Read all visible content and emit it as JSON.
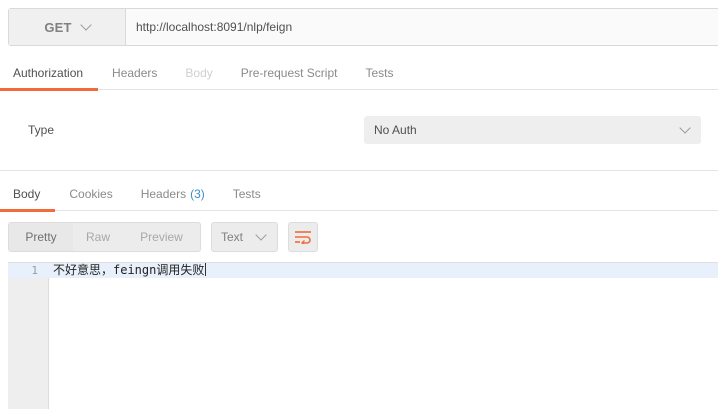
{
  "request": {
    "method": "GET",
    "url": "http://localhost:8091/nlp/feign"
  },
  "request_tabs": [
    {
      "label": "Authorization",
      "state": "active"
    },
    {
      "label": "Headers",
      "state": "normal"
    },
    {
      "label": "Body",
      "state": "disabled"
    },
    {
      "label": "Pre-request Script",
      "state": "normal"
    },
    {
      "label": "Tests",
      "state": "normal"
    }
  ],
  "auth": {
    "type_label": "Type",
    "type_value": "No Auth"
  },
  "response_tabs": [
    {
      "label": "Body",
      "state": "active"
    },
    {
      "label": "Cookies",
      "state": "normal"
    },
    {
      "label": "Headers",
      "count": "(3)",
      "state": "normal"
    },
    {
      "label": "Tests",
      "state": "normal"
    }
  ],
  "response_toolbar": {
    "views": [
      "Pretty",
      "Raw",
      "Preview"
    ],
    "active_view": "Pretty",
    "format": "Text",
    "wrap_icon": "wrap-lines-icon"
  },
  "editor": {
    "line_number": "1",
    "line_text": "不好意思，feingn调用失败"
  },
  "colors": {
    "accent": "#f26b3a",
    "count": "#3a8fc7",
    "line_highlight": "#e8f1fb"
  }
}
